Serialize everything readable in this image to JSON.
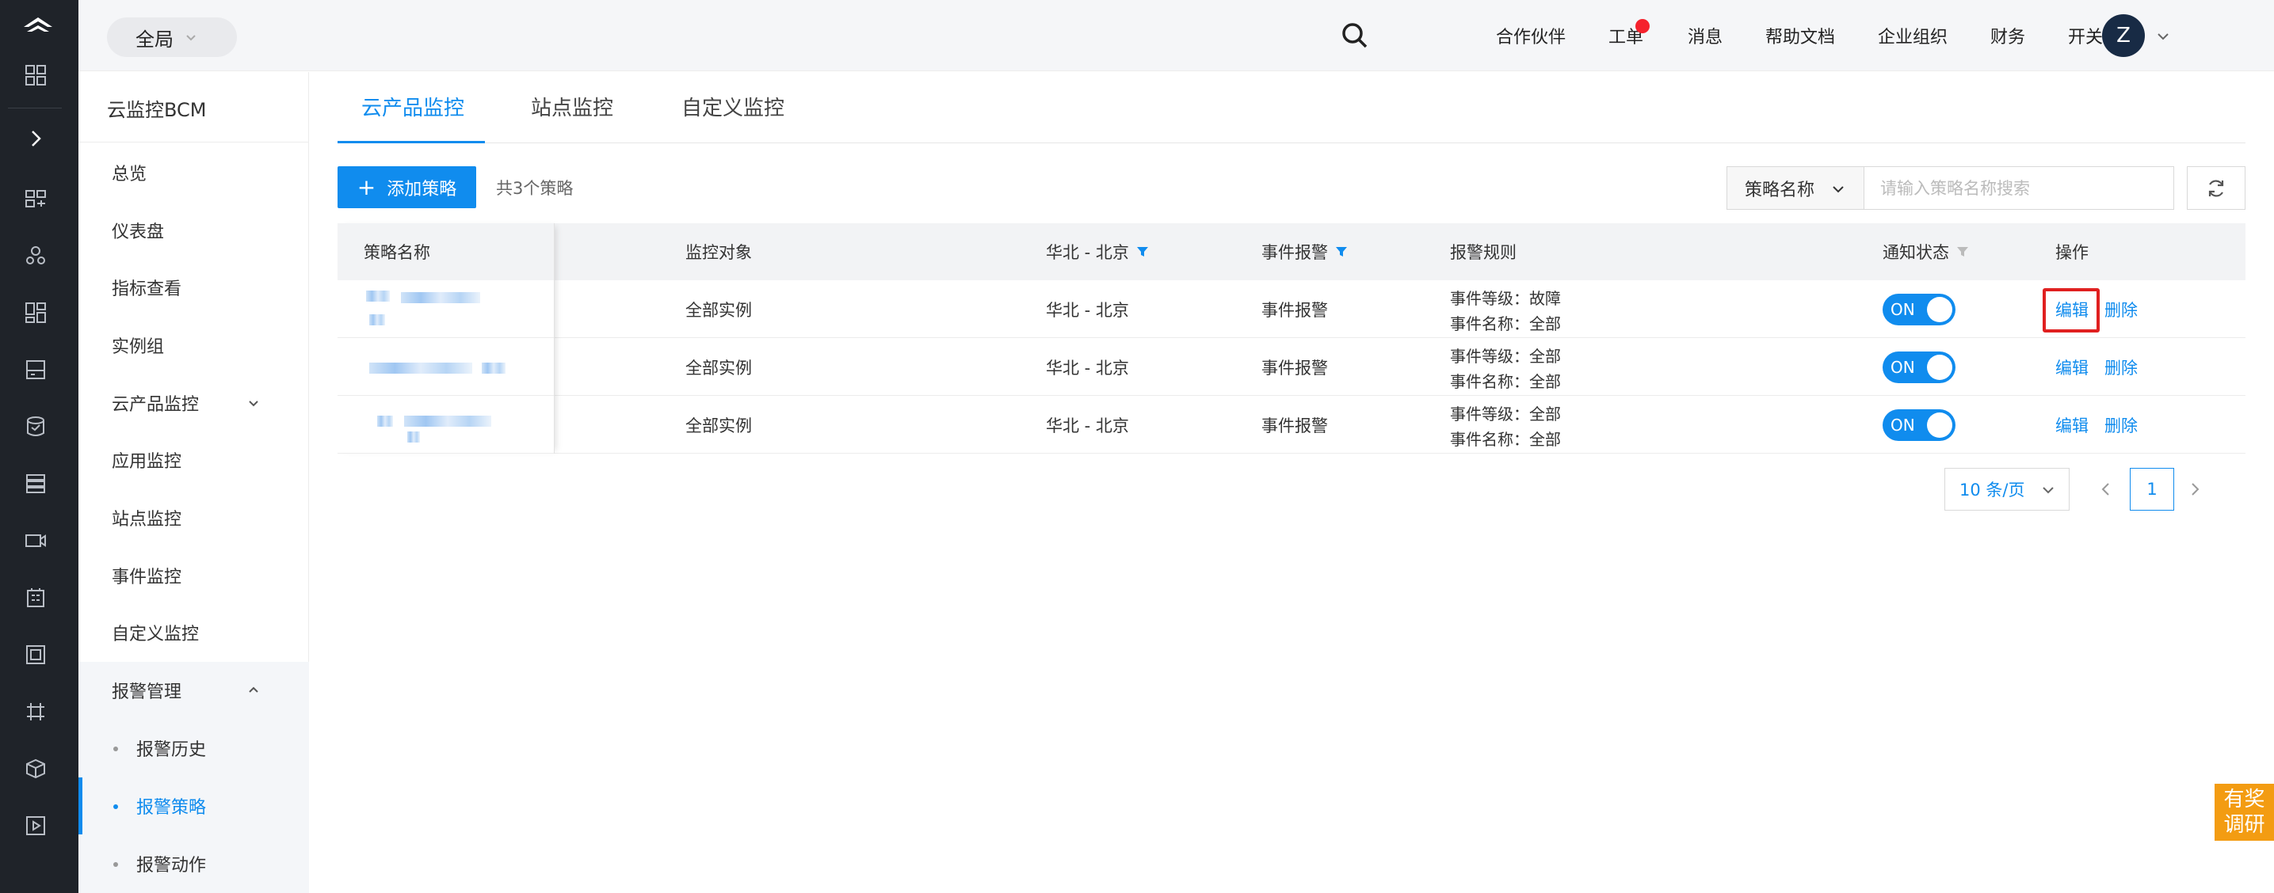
{
  "header": {
    "scope_label": "全局",
    "nav": [
      "合作伙伴",
      "工单",
      "消息",
      "帮助文档",
      "企业组织",
      "财务",
      "开关配置"
    ],
    "avatar_letter": "Z"
  },
  "rail_icons": [
    "logo-icon",
    "apps-grid-icon",
    "expand-arrow-icon",
    "monitor-icon",
    "team-icon",
    "dashboard-icon",
    "storage-icon",
    "database-icon",
    "list-icon",
    "video-icon",
    "building-icon",
    "frame-icon",
    "network-icon",
    "box-icon",
    "play-icon"
  ],
  "sidebar": {
    "title": "云监控BCM",
    "items": [
      "总览",
      "仪表盘",
      "指标查看",
      "实例组",
      "云产品监控",
      "应用监控",
      "站点监控",
      "事件监控",
      "自定义监控"
    ],
    "group": {
      "label": "报警管理",
      "children": [
        "报警历史",
        "报警策略",
        "报警动作"
      ],
      "active": "报警策略"
    }
  },
  "tabs": [
    "云产品监控",
    "站点监控",
    "自定义监控"
  ],
  "toolbar": {
    "add_label": "添加策略",
    "count_text": "共3个策略",
    "filter_select": "策略名称",
    "search_placeholder": "请输入策略名称搜索"
  },
  "table": {
    "columns": [
      "策略名称",
      "监控对象",
      "华北 - 北京",
      "事件报警",
      "报警规则",
      "通知状态",
      "操作"
    ],
    "rows": [
      {
        "target": "全部实例",
        "region": "华北 - 北京",
        "type": "事件报警",
        "rule_level": "事件等级：故障",
        "rule_name": "事件名称：全部",
        "status": "ON",
        "edit": "编辑",
        "delete": "删除"
      },
      {
        "target": "全部实例",
        "region": "华北 - 北京",
        "type": "事件报警",
        "rule_level": "事件等级：全部",
        "rule_name": "事件名称：全部",
        "status": "ON",
        "edit": "编辑",
        "delete": "删除"
      },
      {
        "target": "全部实例",
        "region": "华北 - 北京",
        "type": "事件报警",
        "rule_level": "事件等级：全部",
        "rule_name": "事件名称：全部",
        "status": "ON",
        "edit": "编辑",
        "delete": "删除"
      }
    ]
  },
  "pagination": {
    "page_size": "10 条/页",
    "current": "1"
  },
  "survey": {
    "line1": "有奖",
    "line2": "调研"
  },
  "colors": {
    "accent": "#108cee",
    "rail": "#1f2329",
    "alert": "#e02020",
    "badge": "#f5222d",
    "survey": "#f39c12"
  }
}
